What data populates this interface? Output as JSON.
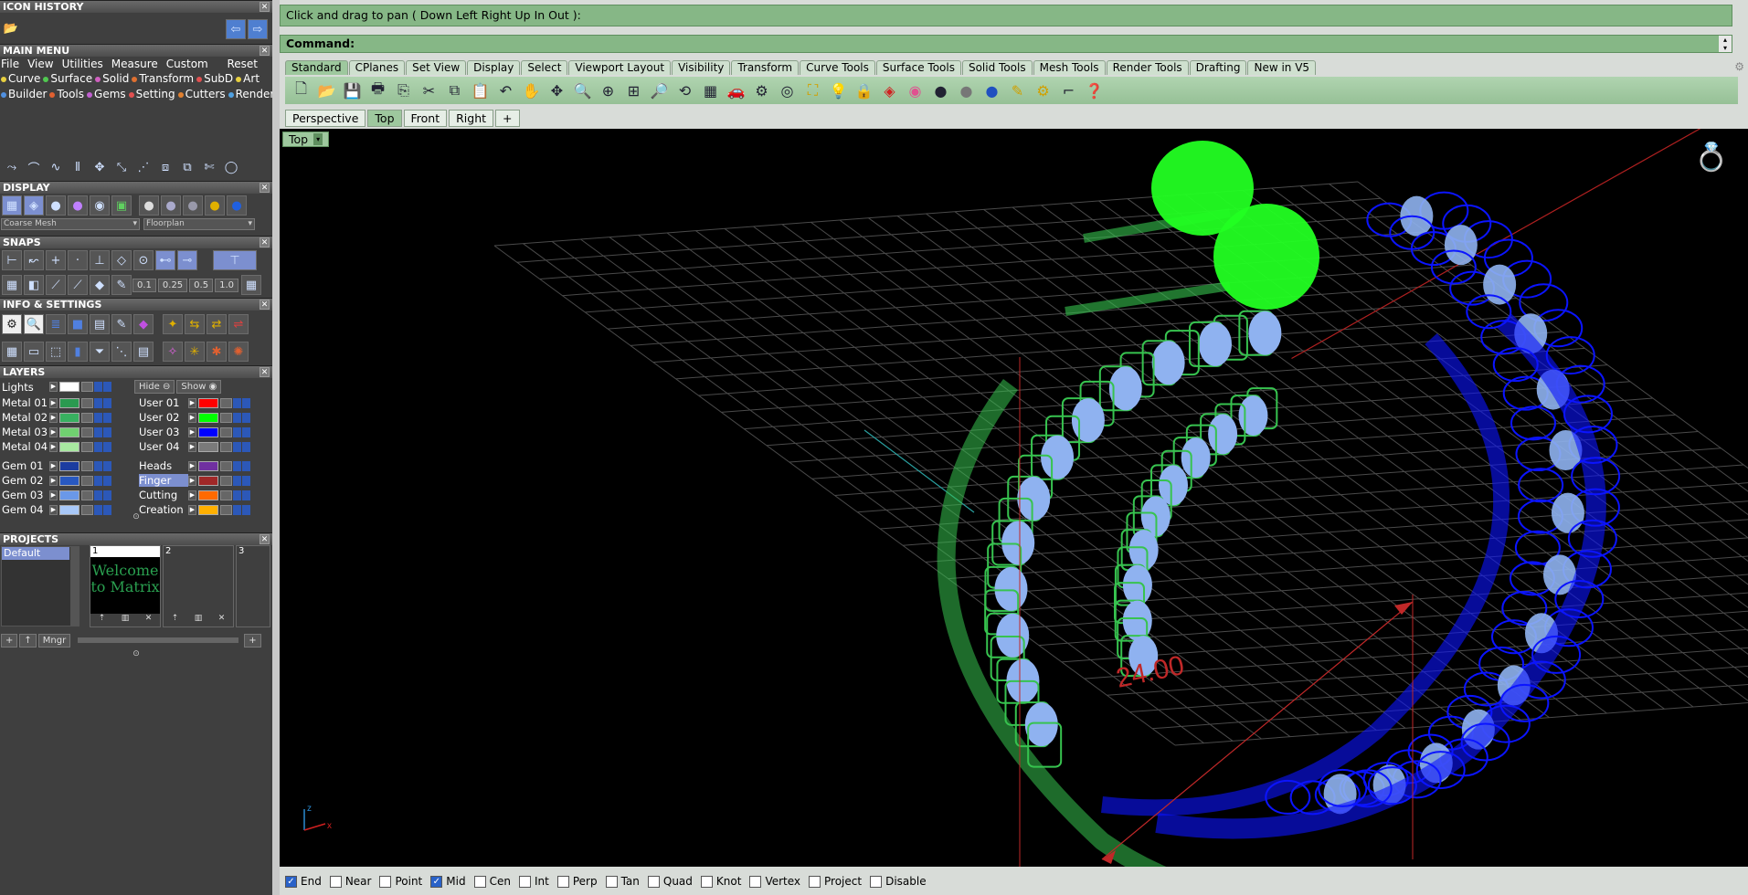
{
  "panels": {
    "icon_history": "ICON HISTORY",
    "main_menu": "MAIN MENU",
    "display": "DISPLAY",
    "snaps": "SNAPS",
    "info_settings": "INFO & SETTINGS",
    "layers": "LAYERS",
    "projects": "PROJECTS"
  },
  "menu": {
    "top": [
      "File",
      "View",
      "Utilities",
      "Measure",
      "Custom"
    ],
    "reset": "Reset",
    "row1": [
      {
        "label": "Curve",
        "color": "#e8d040"
      },
      {
        "label": "Surface",
        "color": "#50c850"
      },
      {
        "label": "Solid",
        "color": "#d060c0"
      },
      {
        "label": "Transform",
        "color": "#e07030"
      },
      {
        "label": "SubD",
        "color": "#e05050"
      },
      {
        "label": "Art",
        "color": "#e8d040"
      }
    ],
    "row2": [
      {
        "label": "Builder",
        "color": "#5090e0"
      },
      {
        "label": "Tools",
        "color": "#e06030"
      },
      {
        "label": "Gems",
        "color": "#c060d0"
      },
      {
        "label": "Setting",
        "color": "#e05050"
      },
      {
        "label": "Cutters",
        "color": "#e08030"
      },
      {
        "label": "Render",
        "color": "#50a0e0"
      }
    ]
  },
  "display": {
    "mesh_select": "Coarse Mesh",
    "env_select": "Floorplan"
  },
  "snaps": {
    "values": [
      "0.1",
      "0.25",
      "0.5",
      "1.0"
    ]
  },
  "layers": {
    "lights": "Lights",
    "hide": "Hide",
    "show": "Show",
    "left": [
      {
        "name": "Metal 01",
        "color": "#2a9a50"
      },
      {
        "name": "Metal 02",
        "color": "#38b060"
      },
      {
        "name": "Metal 03",
        "color": "#70d070"
      },
      {
        "name": "Metal 04",
        "color": "#a8e8a0"
      },
      {
        "name": "Gem 01",
        "color": "#1c3ca0"
      },
      {
        "name": "Gem 02",
        "color": "#2858c0"
      },
      {
        "name": "Gem 03",
        "color": "#6a98e8"
      },
      {
        "name": "Gem 04",
        "color": "#a8c8f8"
      }
    ],
    "right": [
      {
        "name": "User 01",
        "color": "#ff0000"
      },
      {
        "name": "User 02",
        "color": "#00ff00"
      },
      {
        "name": "User 03",
        "color": "#0000ff"
      },
      {
        "name": "User 04",
        "color": "#7a7a7a"
      },
      {
        "name": "Heads",
        "color": "#7030a0"
      },
      {
        "name": "Finger",
        "color": "#a02828"
      },
      {
        "name": "Cutting",
        "color": "#ff6a00"
      },
      {
        "name": "Creation",
        "color": "#ffb000"
      }
    ]
  },
  "projects": {
    "list_item": "Default",
    "thumbs": [
      "1",
      "2",
      "3"
    ],
    "welcome": "Welcome to Matrix",
    "mngr": "Mngr"
  },
  "status": {
    "prompt": "Click and drag to pan ( Down  Left  Right  Up  In  Out ):",
    "command": "Command:"
  },
  "toolbar_tabs": [
    "Standard",
    "CPlanes",
    "Set View",
    "Display",
    "Select",
    "Viewport Layout",
    "Visibility",
    "Transform",
    "Curve Tools",
    "Surface Tools",
    "Solid Tools",
    "Mesh Tools",
    "Render Tools",
    "Drafting",
    "New in V5"
  ],
  "viewport_tabs": [
    "Perspective",
    "Top",
    "Front",
    "Right"
  ],
  "viewport": {
    "label": "Top",
    "dimension": "24.00",
    "axis_x": "x",
    "axis_z": "z"
  },
  "osnaps": [
    {
      "label": "End",
      "checked": true
    },
    {
      "label": "Near",
      "checked": false
    },
    {
      "label": "Point",
      "checked": false
    },
    {
      "label": "Mid",
      "checked": true
    },
    {
      "label": "Cen",
      "checked": false
    },
    {
      "label": "Int",
      "checked": false
    },
    {
      "label": "Perp",
      "checked": false
    },
    {
      "label": "Tan",
      "checked": false
    },
    {
      "label": "Quad",
      "checked": false
    },
    {
      "label": "Knot",
      "checked": false
    },
    {
      "label": "Vertex",
      "checked": false
    },
    {
      "label": "Project",
      "checked": false
    },
    {
      "label": "Disable",
      "checked": false
    }
  ],
  "colors": {
    "green_metal": "#37c34f",
    "blue_metal": "#0b14ff",
    "gem": "#8fb2f0",
    "head": "#22ff22",
    "dim": "#c02828"
  }
}
